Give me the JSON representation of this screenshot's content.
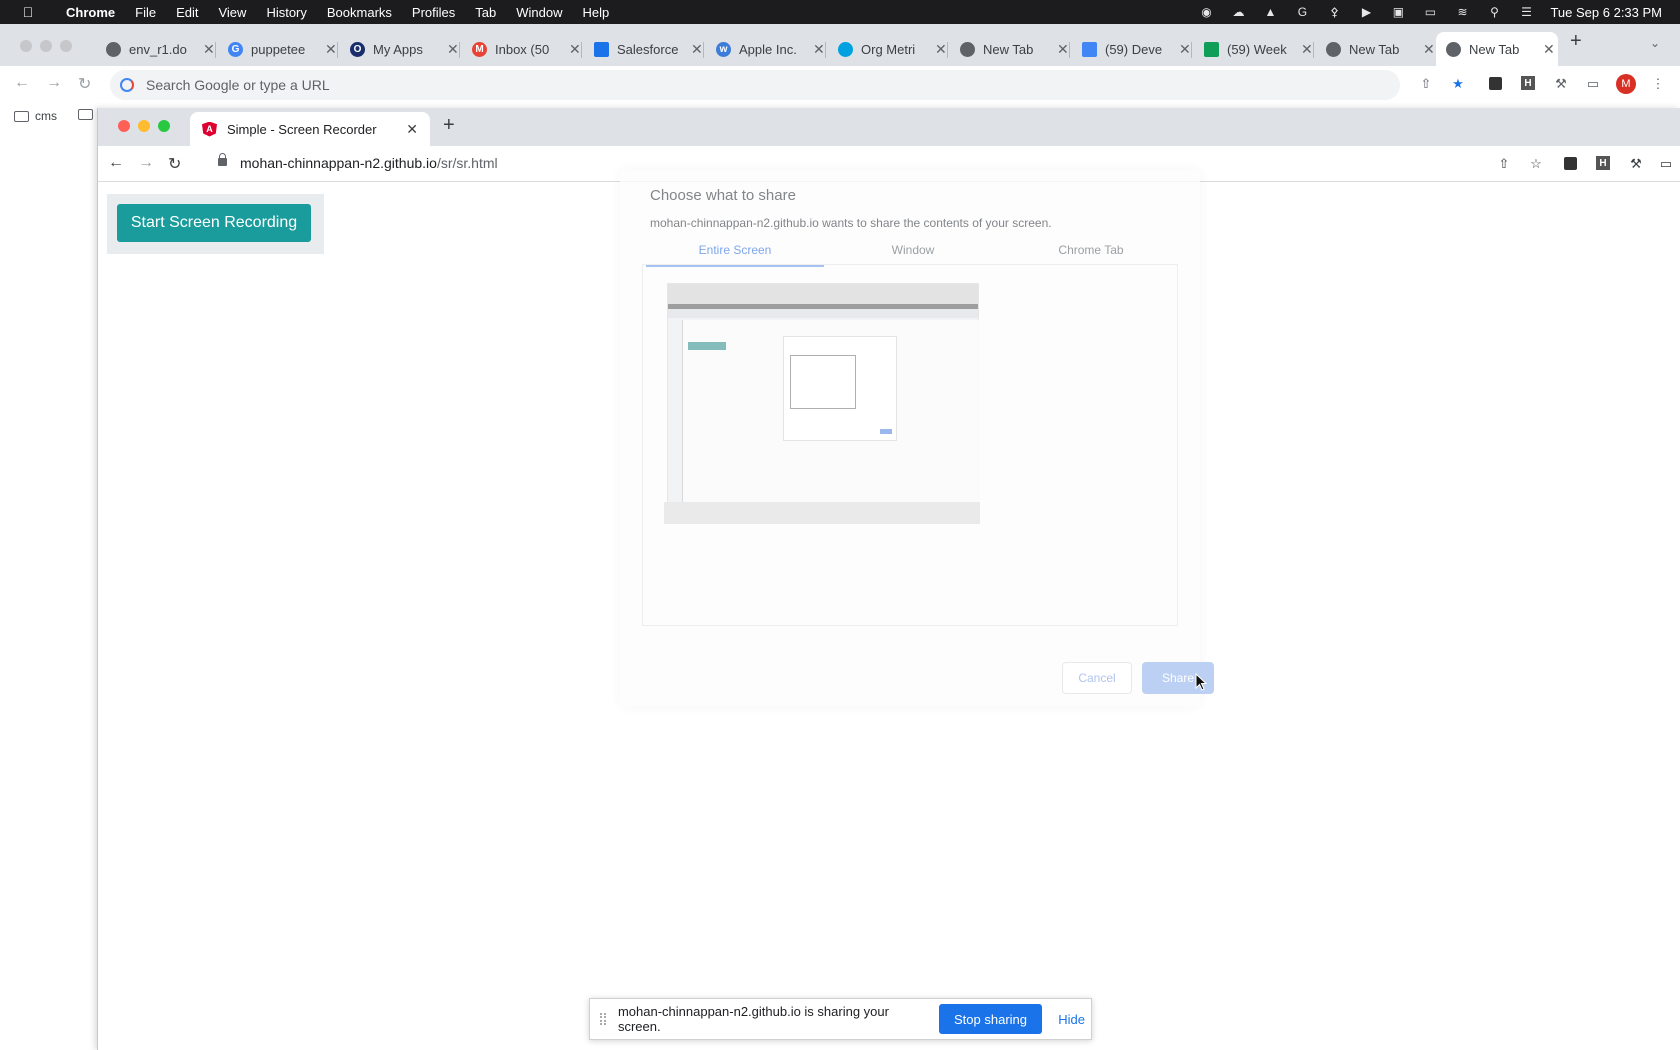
{
  "menubar": {
    "items": [
      "Chrome",
      "File",
      "Edit",
      "View",
      "History",
      "Bookmarks",
      "Profiles",
      "Tab",
      "Window",
      "Help"
    ],
    "clock": "Tue Sep 6  2:33 PM"
  },
  "outer_tabs": [
    {
      "title": "env_r1.do",
      "icon": "globe-icon"
    },
    {
      "title": "puppetee",
      "icon": "google-icon"
    },
    {
      "title": "My Apps",
      "icon": "okta-icon"
    },
    {
      "title": "Inbox (50",
      "icon": "gmail-icon"
    },
    {
      "title": "Salesforce",
      "icon": "doc-icon"
    },
    {
      "title": "Apple Inc.",
      "icon": "workday-icon"
    },
    {
      "title": "Org Metri",
      "icon": "salesforce-cloud-icon"
    },
    {
      "title": "New Tab",
      "icon": "chrome-icon"
    },
    {
      "title": "(59) Deve",
      "icon": "docs-icon"
    },
    {
      "title": "(59) Week",
      "icon": "sheets-icon"
    },
    {
      "title": "New Tab",
      "icon": "chrome-icon"
    },
    {
      "title": "New Tab",
      "icon": "chrome-icon",
      "active": true
    }
  ],
  "outer_toolbar": {
    "omnibox_placeholder": "Search Google or type a URL",
    "profile_initial": "M"
  },
  "bookmarks": [
    {
      "label": "cms"
    }
  ],
  "inner": {
    "tab_title": "Simple - Screen Recorder",
    "url_host": "mohan-chinnappan-n2.github.io",
    "url_path": "/sr/sr.html"
  },
  "page": {
    "start_button": "Start Screen Recording"
  },
  "share_dialog": {
    "title": "Choose what to share",
    "subtitle": "mohan-chinnappan-n2.github.io wants to share the contents of your screen.",
    "tabs": [
      "Entire Screen",
      "Window",
      "Chrome Tab"
    ],
    "cancel": "Cancel",
    "share": "Share"
  },
  "sharing_bar": {
    "message": "mohan-chinnappan-n2.github.io is sharing your screen.",
    "stop": "Stop sharing",
    "hide": "Hide"
  },
  "colors": {
    "accent_teal": "#1a9c9c",
    "chrome_blue": "#1a73e8",
    "profile_red": "#d93025"
  }
}
